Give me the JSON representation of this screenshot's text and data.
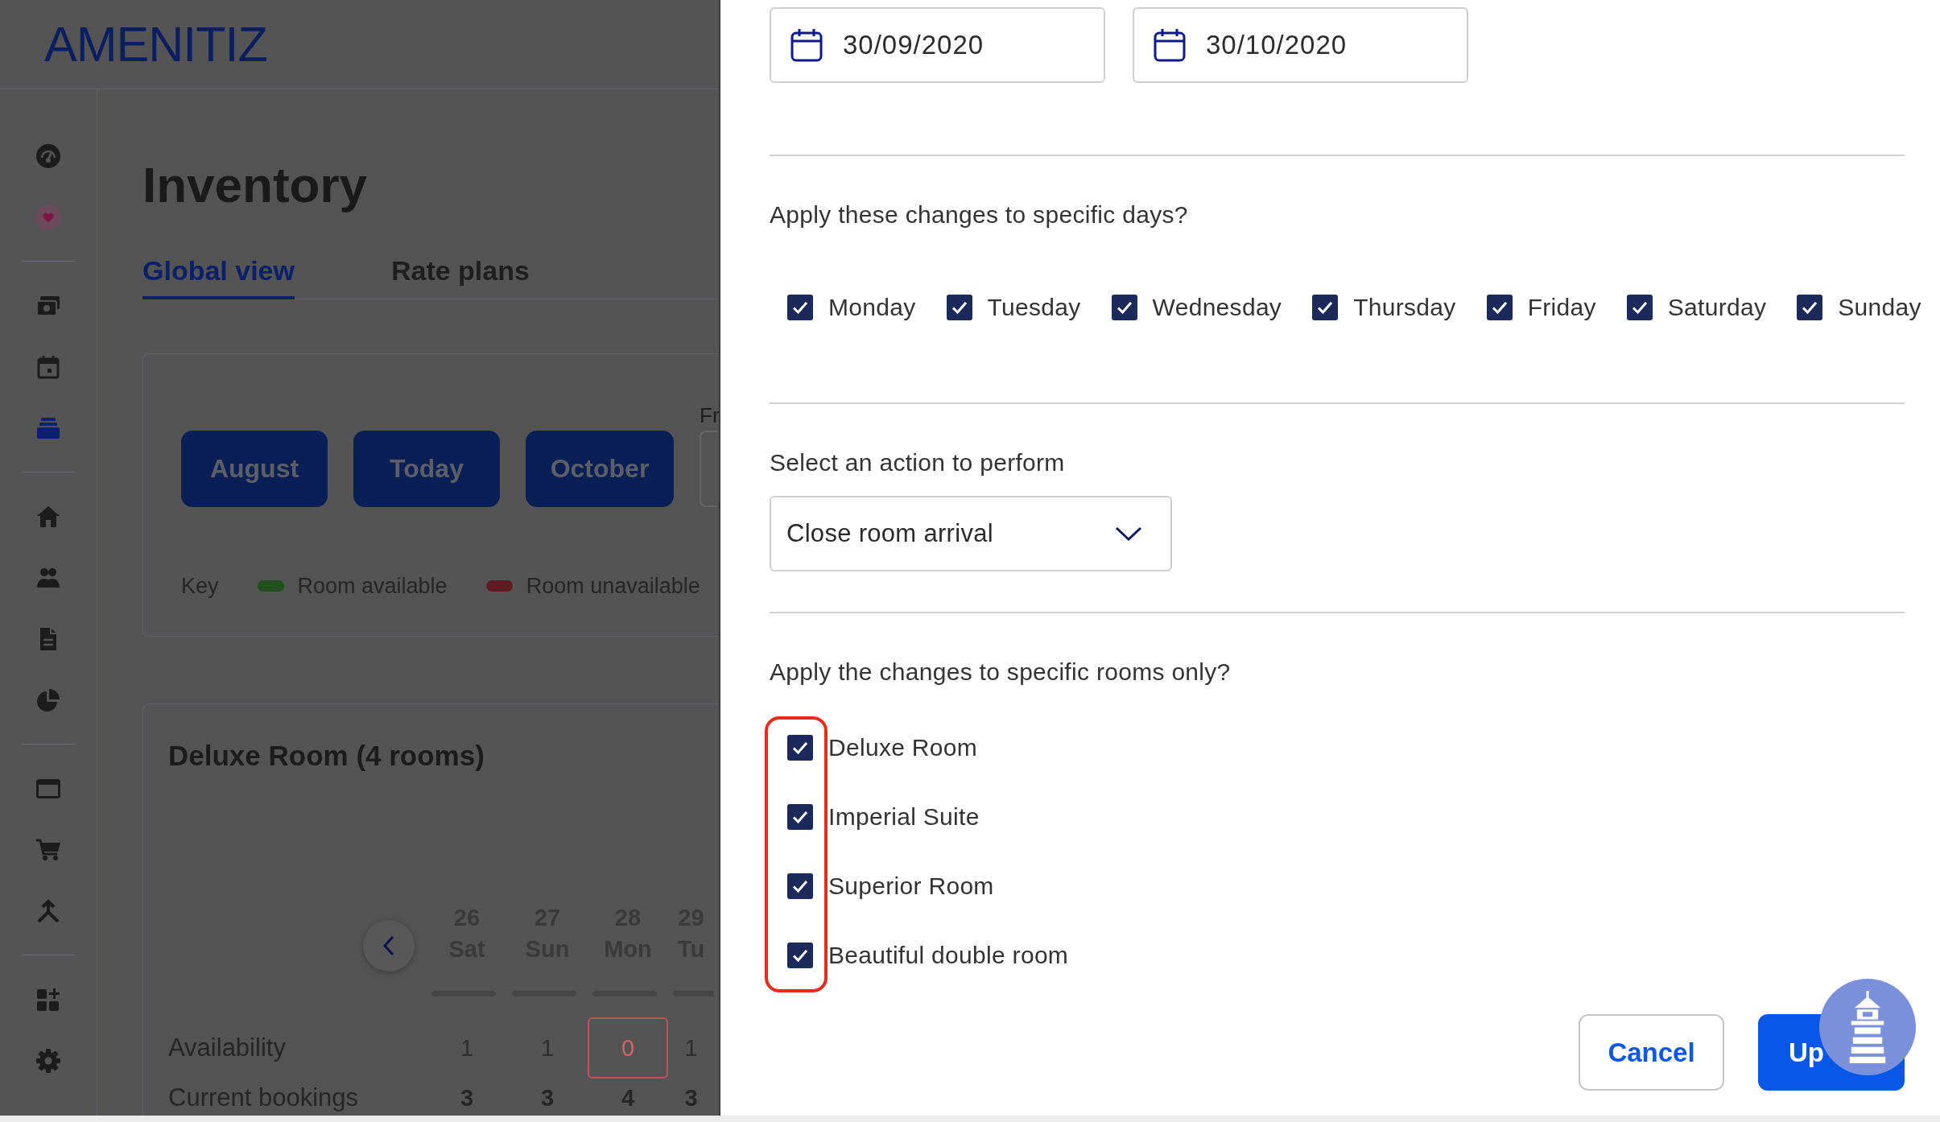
{
  "header": {
    "logo": "AMENITIZ"
  },
  "sidebar": {
    "groups": [
      {
        "items": [
          {
            "selected": false
          },
          {
            "selected": false
          }
        ]
      },
      {
        "items": [
          {
            "selected": false
          },
          {
            "selected": false
          },
          {
            "selected": true
          }
        ]
      },
      {
        "items": [
          {
            "selected": false
          },
          {
            "selected": false
          },
          {
            "selected": false
          },
          {
            "selected": false
          }
        ]
      },
      {
        "items": [
          {
            "selected": false
          },
          {
            "selected": false
          },
          {
            "selected": false
          }
        ]
      },
      {
        "items": [
          {
            "selected": false
          },
          {
            "selected": false
          }
        ]
      }
    ]
  },
  "page": {
    "title": "Inventory",
    "tabs": [
      {
        "label": "Global view",
        "selected": true
      },
      {
        "label": "Rate plans",
        "selected": false
      }
    ]
  },
  "calendar_controls": {
    "buttons": [
      "August",
      "Today",
      "October"
    ],
    "from_label": "Fr",
    "key": {
      "label": "Key",
      "items": [
        {
          "label": "Room available",
          "color": "#22501f"
        },
        {
          "label": "Room unavailable",
          "color": "#611a22"
        }
      ]
    }
  },
  "room_card": {
    "title": "Deluxe Room (4 rooms)",
    "days": [
      {
        "date": "26",
        "weekday": "Sat"
      },
      {
        "date": "27",
        "weekday": "Sun"
      },
      {
        "date": "28",
        "weekday": "Mon"
      },
      {
        "date": "29",
        "weekday": "Tu"
      }
    ],
    "rows": [
      {
        "kind": "availability",
        "label": "Availability",
        "cells": [
          {
            "value": "1",
            "flagged": false
          },
          {
            "value": "1",
            "flagged": false
          },
          {
            "value": "0",
            "flagged": true
          },
          {
            "value": "1",
            "flagged": false
          }
        ]
      },
      {
        "kind": "bookings",
        "label": "Current bookings",
        "cells": [
          {
            "value": "3",
            "flagged": false
          },
          {
            "value": "3",
            "flagged": false
          },
          {
            "value": "4",
            "flagged": false
          },
          {
            "value": "3",
            "flagged": false
          }
        ]
      }
    ]
  },
  "drawer": {
    "date_fields": [
      {
        "value": "30/09/2020"
      },
      {
        "value": "30/10/2020"
      }
    ],
    "days_question": "Apply these changes to specific days?",
    "days": [
      {
        "label": "Monday",
        "checked": true
      },
      {
        "label": "Tuesday",
        "checked": true
      },
      {
        "label": "Wednesday",
        "checked": true
      },
      {
        "label": "Thursday",
        "checked": true
      },
      {
        "label": "Friday",
        "checked": true
      },
      {
        "label": "Saturday",
        "checked": true
      },
      {
        "label": "Sunday",
        "checked": true
      }
    ],
    "action": {
      "label": "Select an action to perform",
      "value": "Close room arrival"
    },
    "rooms_question": "Apply the changes to specific rooms only?",
    "rooms": {
      "highlighted": true,
      "items": [
        {
          "label": "Deluxe Room",
          "checked": true
        },
        {
          "label": "Imperial Suite",
          "checked": true
        },
        {
          "label": "Superior Room",
          "checked": true
        },
        {
          "label": "Beautiful double room",
          "checked": true
        }
      ]
    },
    "buttons": [
      {
        "kind": "secondary",
        "label": "Cancel"
      },
      {
        "kind": "primary",
        "label": "Up"
      }
    ]
  }
}
